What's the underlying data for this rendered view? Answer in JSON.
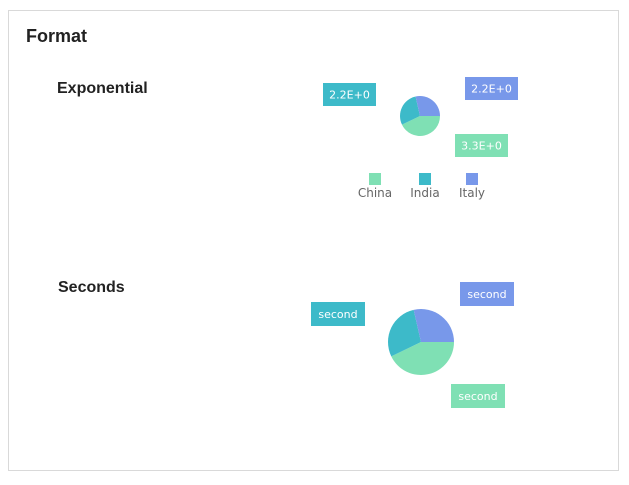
{
  "panel": {
    "title": "Format"
  },
  "chart_data": [
    {
      "type": "pie",
      "title": "Exponential",
      "categories": [
        "China",
        "India",
        "Italy"
      ],
      "values": [
        3.3,
        2.2,
        2.2
      ],
      "data_labels": [
        "3.3E+0",
        "2.2E+0",
        "2.2E+0"
      ],
      "legend": {
        "show": true,
        "placement": "bottom",
        "entries": [
          "China",
          "India",
          "Italy"
        ]
      }
    },
    {
      "type": "pie",
      "title": "Seconds",
      "categories": [
        "China",
        "India",
        "Italy"
      ],
      "values": [
        3.3,
        2.2,
        2.2
      ],
      "data_labels": [
        "second",
        "second",
        "second"
      ],
      "legend": {
        "show": false
      }
    }
  ],
  "colors": {
    "China": "#7fe0b4",
    "India": "#3dbac9",
    "Italy": "#7898ea"
  }
}
